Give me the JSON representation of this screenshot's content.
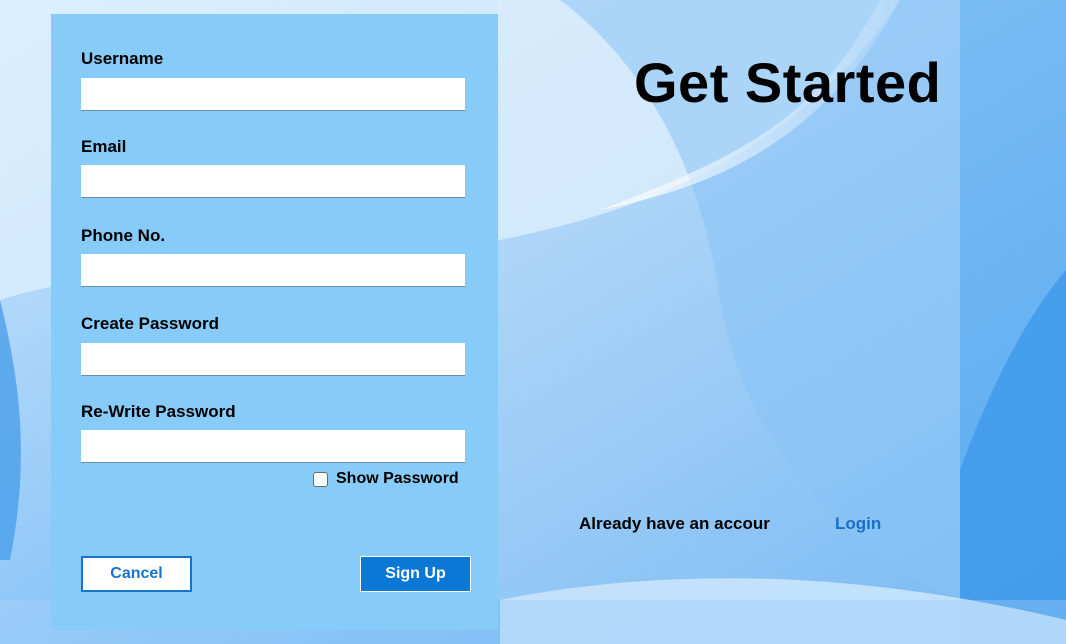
{
  "form": {
    "fields": [
      {
        "label": "Username",
        "value": ""
      },
      {
        "label": "Email",
        "value": ""
      },
      {
        "label": "Phone No.",
        "value": ""
      },
      {
        "label": "Create Password",
        "value": ""
      },
      {
        "label": "Re-Write Password",
        "value": ""
      }
    ],
    "show_password_label": "Show Password",
    "show_password_checked": false,
    "cancel_label": "Cancel",
    "signup_label": "Sign Up"
  },
  "right": {
    "title": "Get Started",
    "already_text": "Already have an accour",
    "login_label": "Login"
  },
  "colors": {
    "form_panel": "#87cbf8",
    "primary_button": "#0a78d4",
    "link": "#1a6fc4",
    "background": "#5aaaf0"
  }
}
